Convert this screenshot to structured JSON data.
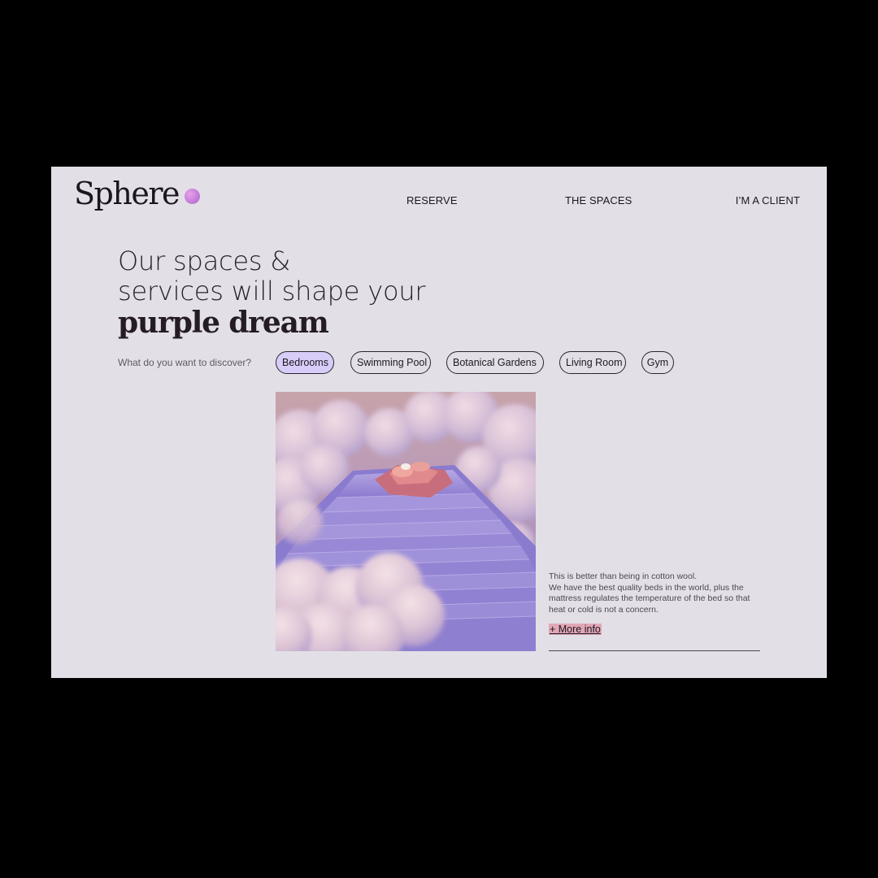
{
  "brand": {
    "name": "Sphere",
    "dot_color": "#c57ed9"
  },
  "nav": {
    "items": [
      {
        "label": "RESERVE"
      },
      {
        "label": "THE SPACES"
      },
      {
        "label": "I’M A CLIENT"
      }
    ]
  },
  "hero": {
    "line1": "Our spaces &",
    "line2": "services will shape your",
    "line3": "purple dream"
  },
  "discover": {
    "label": "What do you want to discover?",
    "chips": [
      {
        "label": "Bedrooms",
        "active": true
      },
      {
        "label": "Swimming Pool",
        "active": false
      },
      {
        "label": "Botanical Gardens",
        "active": false
      },
      {
        "label": "Living Room",
        "active": false
      },
      {
        "label": "Gym",
        "active": false
      }
    ]
  },
  "feature": {
    "image_subject": "bed-on-cloud-steps-image",
    "description_line1": "This is better than being in cotton wool.",
    "description_line2": "We have the best quality beds in the world, plus the mattress regulates the temperature of the bed so that heat or cold is not a concern.",
    "more_info": "+ More info"
  },
  "colors": {
    "background": "#e2e0e6",
    "active_chip": "#d7cdf8",
    "more_info_highlight": "#e1a7b6",
    "text": "#221c26"
  }
}
